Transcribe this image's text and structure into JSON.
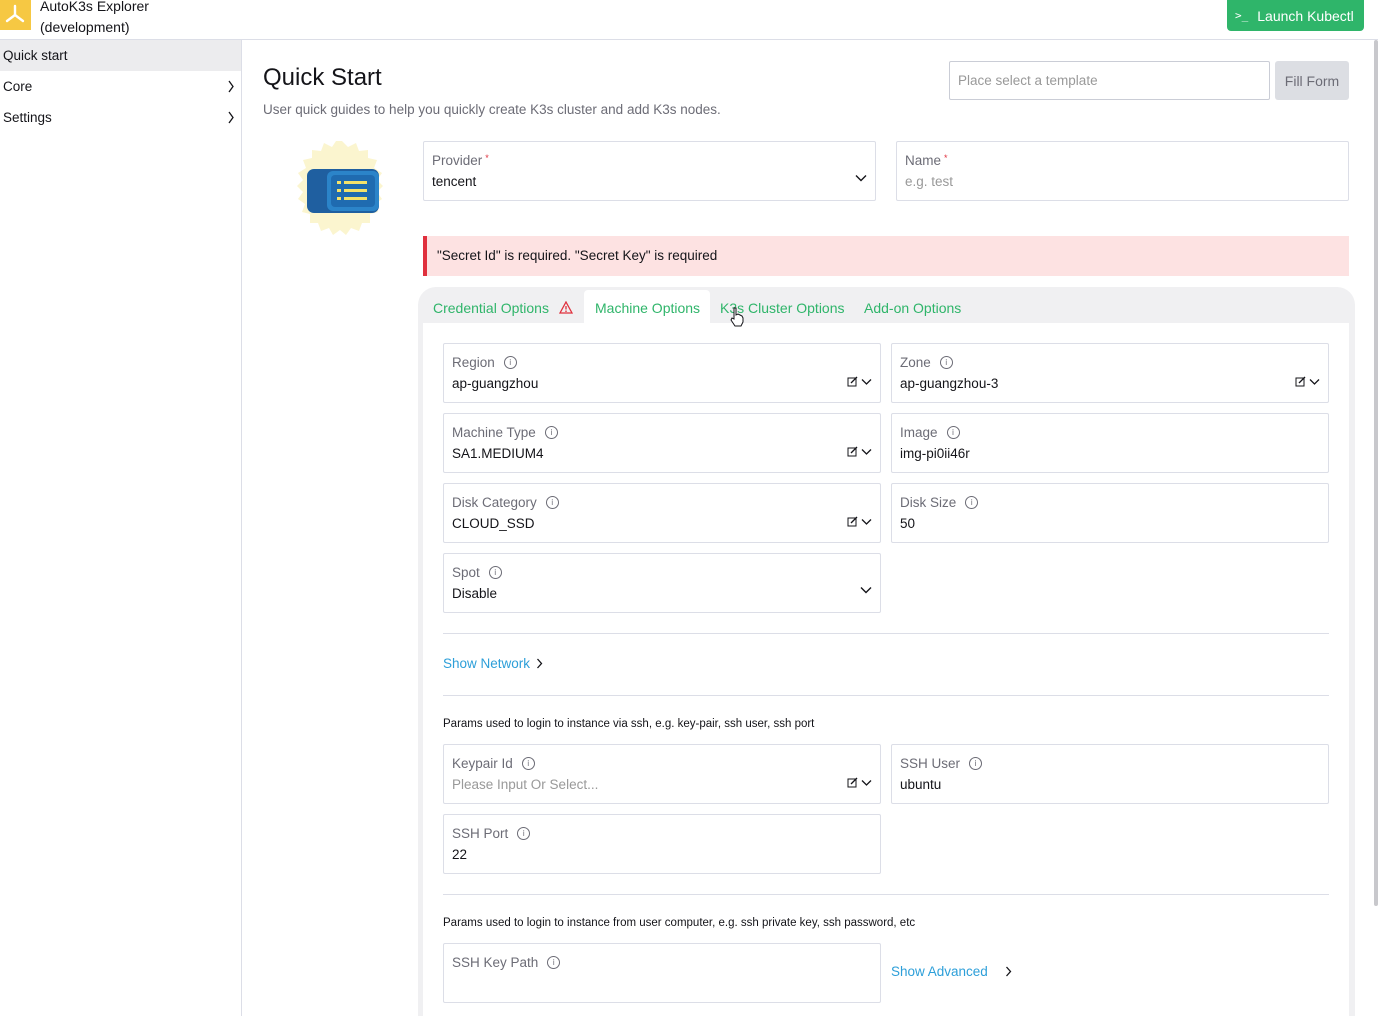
{
  "app": {
    "title_line1": "AutoK3s Explorer",
    "title_line2": "(development)",
    "launch_prompt": ">_",
    "launch_label": "Launch Kubectl"
  },
  "sidebar": {
    "items": [
      {
        "label": "Quick start",
        "active": true
      },
      {
        "label": "Core",
        "has_children": true
      },
      {
        "label": "Settings",
        "has_children": true
      }
    ]
  },
  "page": {
    "title": "Quick Start",
    "subtitle": "User quick guides to help you quickly create K3s cluster and add K3s nodes.",
    "template_placeholder": "Place select a template",
    "fill_form_label": "Fill Form"
  },
  "form": {
    "provider": {
      "label": "Provider",
      "required": "*",
      "value": "tencent"
    },
    "name": {
      "label": "Name",
      "required": "*",
      "placeholder": "e.g. test"
    }
  },
  "alert": {
    "message": "\"Secret Id\" is required. \"Secret Key\" is required"
  },
  "tabs": [
    {
      "label": "Credential Options",
      "warning": true
    },
    {
      "label": "Machine Options",
      "active": true
    },
    {
      "label": "K3s Cluster Options"
    },
    {
      "label": "Add-on Options"
    }
  ],
  "machine": {
    "region": {
      "label": "Region",
      "value": "ap-guangzhou"
    },
    "zone": {
      "label": "Zone",
      "value": "ap-guangzhou-3"
    },
    "machine_type": {
      "label": "Machine Type",
      "value": "SA1.MEDIUM4"
    },
    "image": {
      "label": "Image",
      "value": "img-pi0ii46r"
    },
    "disk_category": {
      "label": "Disk Category",
      "value": "CLOUD_SSD"
    },
    "disk_size": {
      "label": "Disk Size",
      "value": "50"
    },
    "spot": {
      "label": "Spot",
      "value": "Disable"
    }
  },
  "show_network": "Show Network",
  "ssh_note": "Params used to login to instance via ssh, e.g. key-pair, ssh user, ssh port",
  "ssh": {
    "keypair": {
      "label": "Keypair Id",
      "placeholder": "Please Input Or Select..."
    },
    "user": {
      "label": "SSH User",
      "value": "ubuntu"
    },
    "port": {
      "label": "SSH Port",
      "value": "22"
    }
  },
  "local_note": "Params used to login to instance from user computer, e.g. ssh private key, ssh password, etc",
  "ssh_key_path": {
    "label": "SSH Key Path",
    "value": ""
  },
  "show_advanced": "Show Advanced",
  "colors": {
    "accent": "#2fb56a",
    "link": "#2d9fd9",
    "error": "#e0303d",
    "logo": "#f6c843"
  },
  "icons": {
    "info": "info-icon",
    "edit": "edit-icon",
    "chevron": "chevron-down-icon",
    "warning": "warning-icon"
  }
}
